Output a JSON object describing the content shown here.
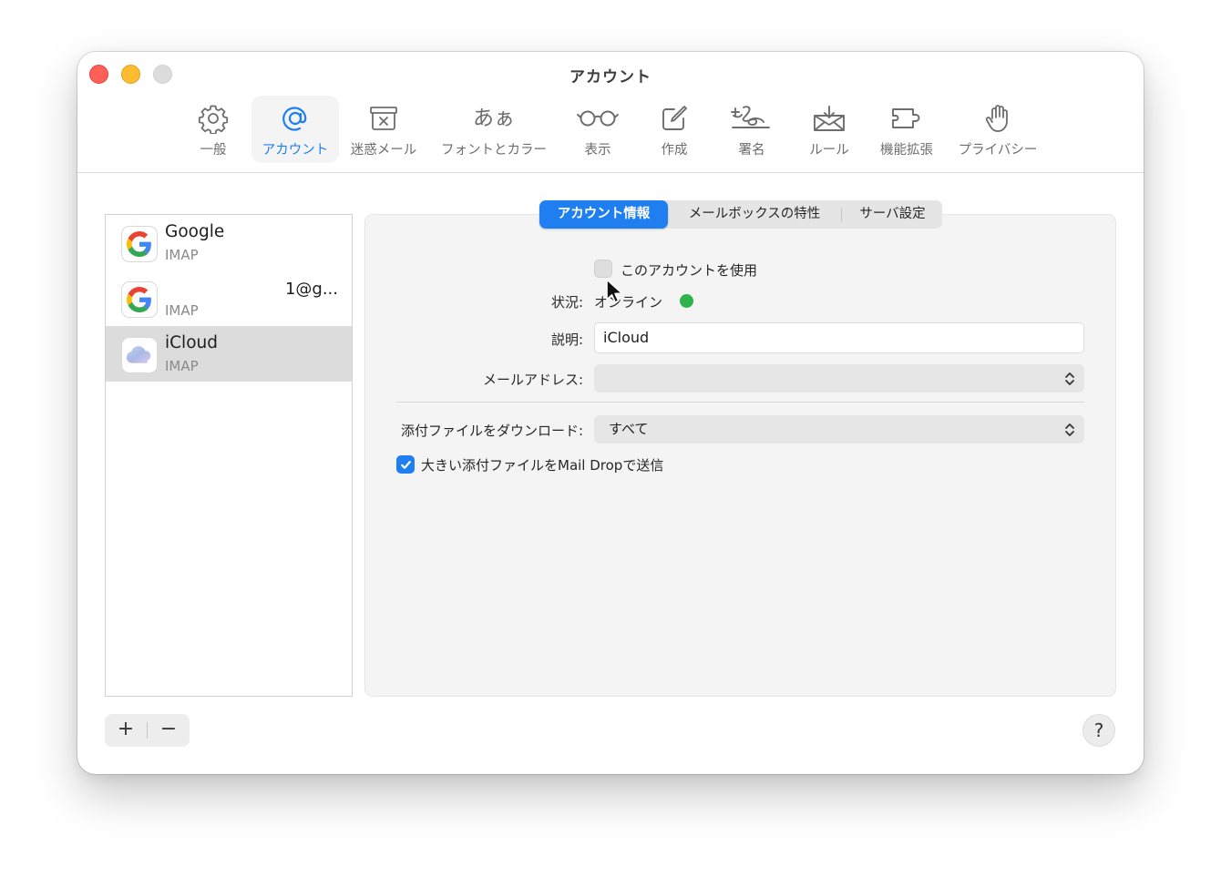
{
  "window": {
    "title": "アカウント"
  },
  "toolbar": {
    "items": [
      {
        "label": "一般",
        "icon": "gear-icon"
      },
      {
        "label": "アカウント",
        "icon": "at-sign-icon",
        "active": true
      },
      {
        "label": "迷惑メール",
        "icon": "junk-trash-icon"
      },
      {
        "label": "フォントとカラー",
        "icon": "font-glyph-icon",
        "glyph": "あぁ"
      },
      {
        "label": "表示",
        "icon": "glasses-icon"
      },
      {
        "label": "作成",
        "icon": "compose-icon"
      },
      {
        "label": "署名",
        "icon": "signature-icon"
      },
      {
        "label": "ルール",
        "icon": "rules-envelope-icon"
      },
      {
        "label": "機能拡張",
        "icon": "extension-icon"
      },
      {
        "label": "プライバシー",
        "icon": "hand-icon"
      }
    ]
  },
  "accounts": [
    {
      "name": "Google",
      "type": "IMAP",
      "email": "",
      "icon": "google-logo-icon"
    },
    {
      "name": "",
      "type": "IMAP",
      "email": "1@g...",
      "icon": "google-logo-icon"
    },
    {
      "name": "iCloud",
      "type": "IMAP",
      "email": "",
      "icon": "icloud-icon",
      "selected": true
    }
  ],
  "list_buttons": {
    "add": "+",
    "remove": "−"
  },
  "help": "?",
  "tabs": [
    {
      "label": "アカウント情報",
      "active": true
    },
    {
      "label": "メールボックスの特性"
    },
    {
      "label": "サーバ設定"
    }
  ],
  "form": {
    "use_account_label": "このアカウントを使用",
    "status_label": "状況:",
    "status_value": "オンライン",
    "status_color": "#2fb34a",
    "description_label": "説明:",
    "description_value": "iCloud",
    "email_label": "メールアドレス:",
    "email_value": "",
    "download_label": "添付ファイルをダウンロード:",
    "download_value": "すべて",
    "mail_drop_label": "大きい添付ファイルをMail Dropで送信",
    "mail_drop_checked": true
  },
  "colors": {
    "accent": "#1f7ff0",
    "close": "#fe5f57",
    "minimize": "#febc2e",
    "zoom": "#dcdcdc"
  }
}
